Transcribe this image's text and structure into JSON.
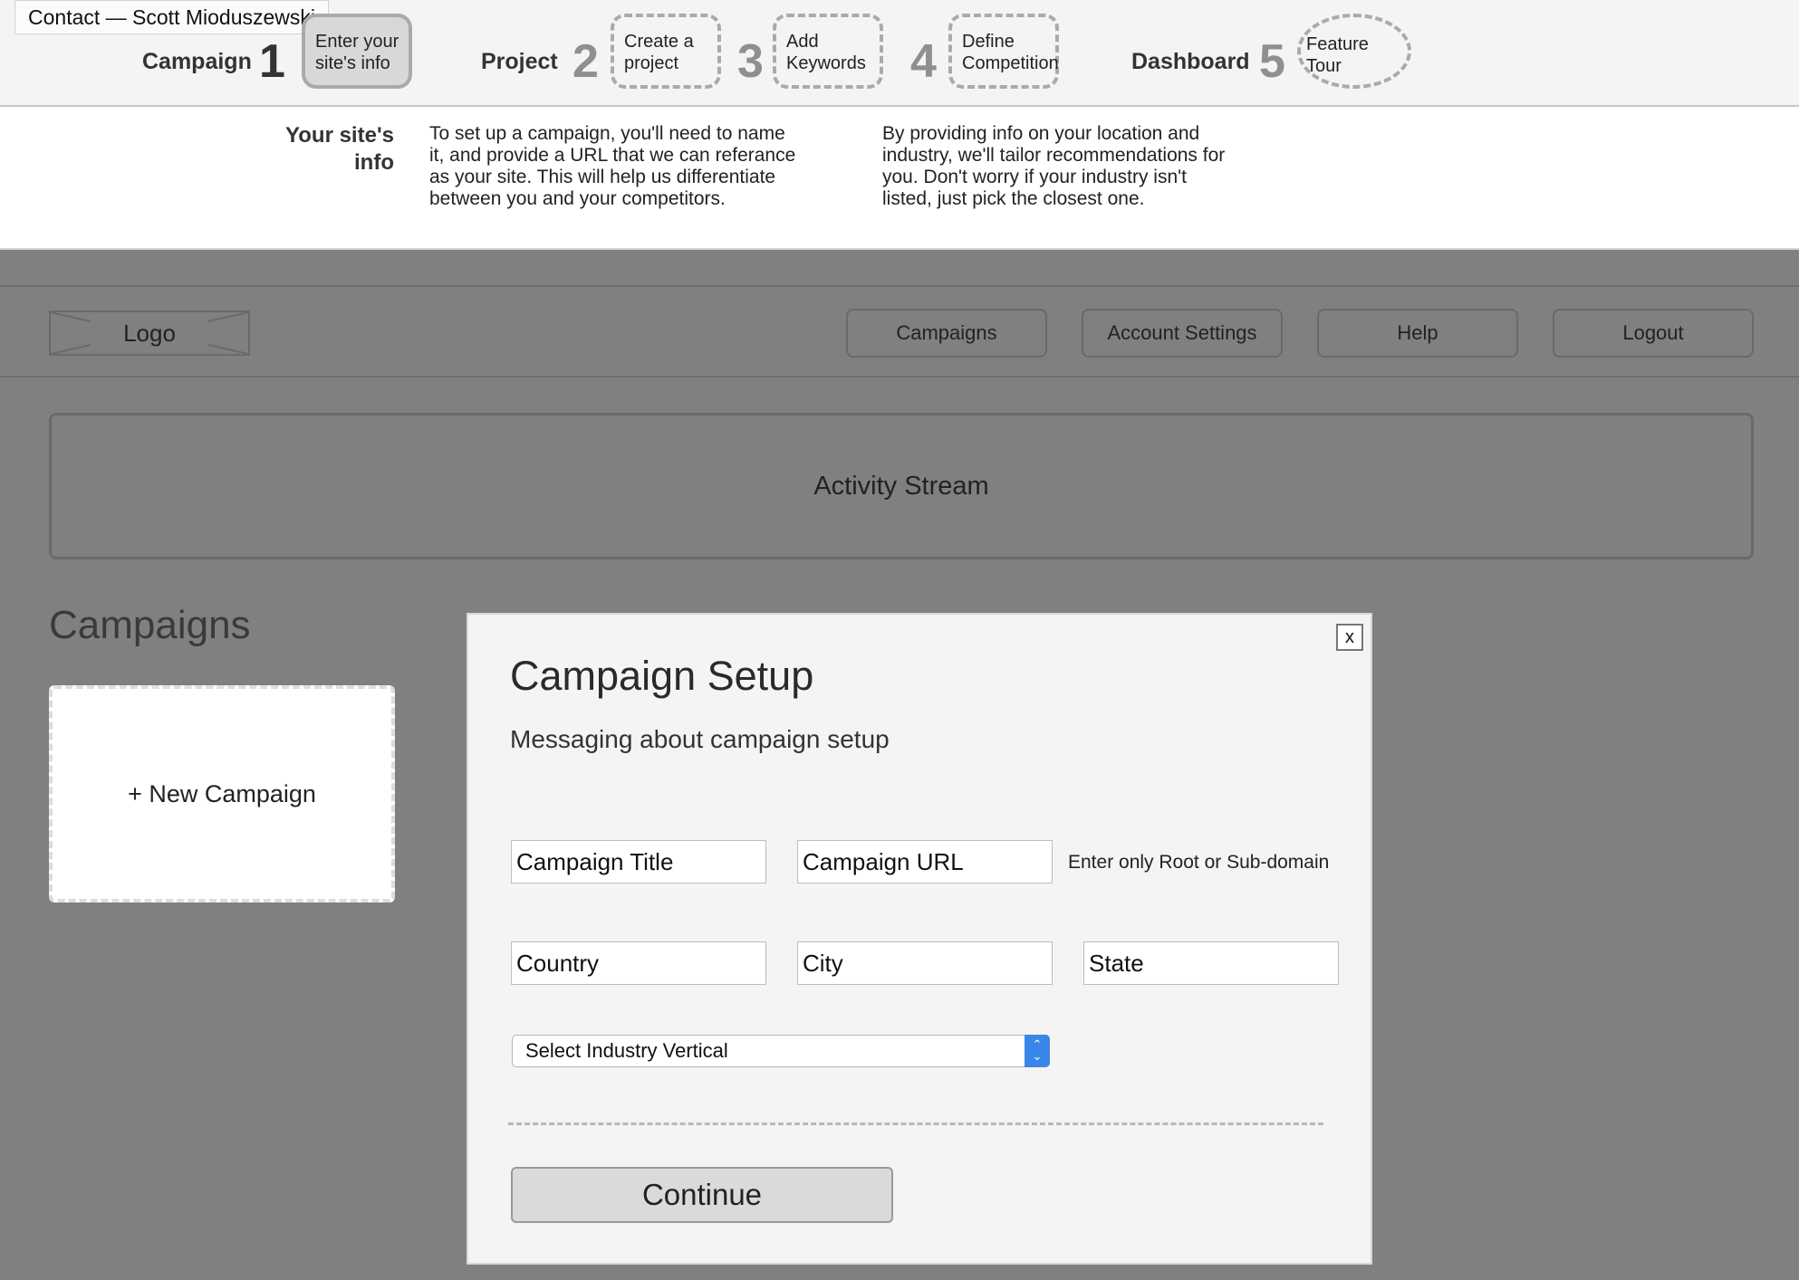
{
  "tooltip": "Contact — Scott Mioduszewski",
  "wizard": {
    "groups": {
      "campaign": "Campaign",
      "project": "Project",
      "dashboard": "Dashboard"
    },
    "steps": [
      {
        "num": "1",
        "line1": "Enter your",
        "line2": "site's info",
        "active": true
      },
      {
        "num": "2",
        "line1": "Create a",
        "line2": "project"
      },
      {
        "num": "3",
        "line1": "Add",
        "line2": "Keywords"
      },
      {
        "num": "4",
        "line1": "Define",
        "line2": "Competition"
      },
      {
        "num": "5",
        "line1": "Feature Tour",
        "line2": ""
      }
    ]
  },
  "info": {
    "title_line1": "Your site's",
    "title_line2": "info",
    "col1": [
      "To set up a campaign, you'll need to name",
      "it, and provide a URL that we can referance",
      "as your site. This will help us differentiate",
      "between you and your competitors."
    ],
    "col2": [
      "By providing info on your location and",
      "industry, we'll tailor recommendations for",
      "you. Don't worry if your industry isn't",
      "listed, just pick the closest one."
    ]
  },
  "nav": {
    "logo": "Logo",
    "buttons": [
      "Campaigns",
      "Account Settings",
      "Help",
      "Logout"
    ]
  },
  "activity": "Activity Stream",
  "campaigns": {
    "title": "Campaigns",
    "new_label": "+ New Campaign"
  },
  "modal": {
    "close": "x",
    "title": "Campaign Setup",
    "subtitle": "Messaging about campaign setup",
    "fields": {
      "title_placeholder": "Campaign Title",
      "url_placeholder": "Campaign URL",
      "url_hint": "Enter only Root or Sub-domain",
      "country_placeholder": "Country",
      "city_placeholder": "City",
      "state_placeholder": "State"
    },
    "industry_select": "Select Industry Vertical",
    "continue": "Continue"
  }
}
